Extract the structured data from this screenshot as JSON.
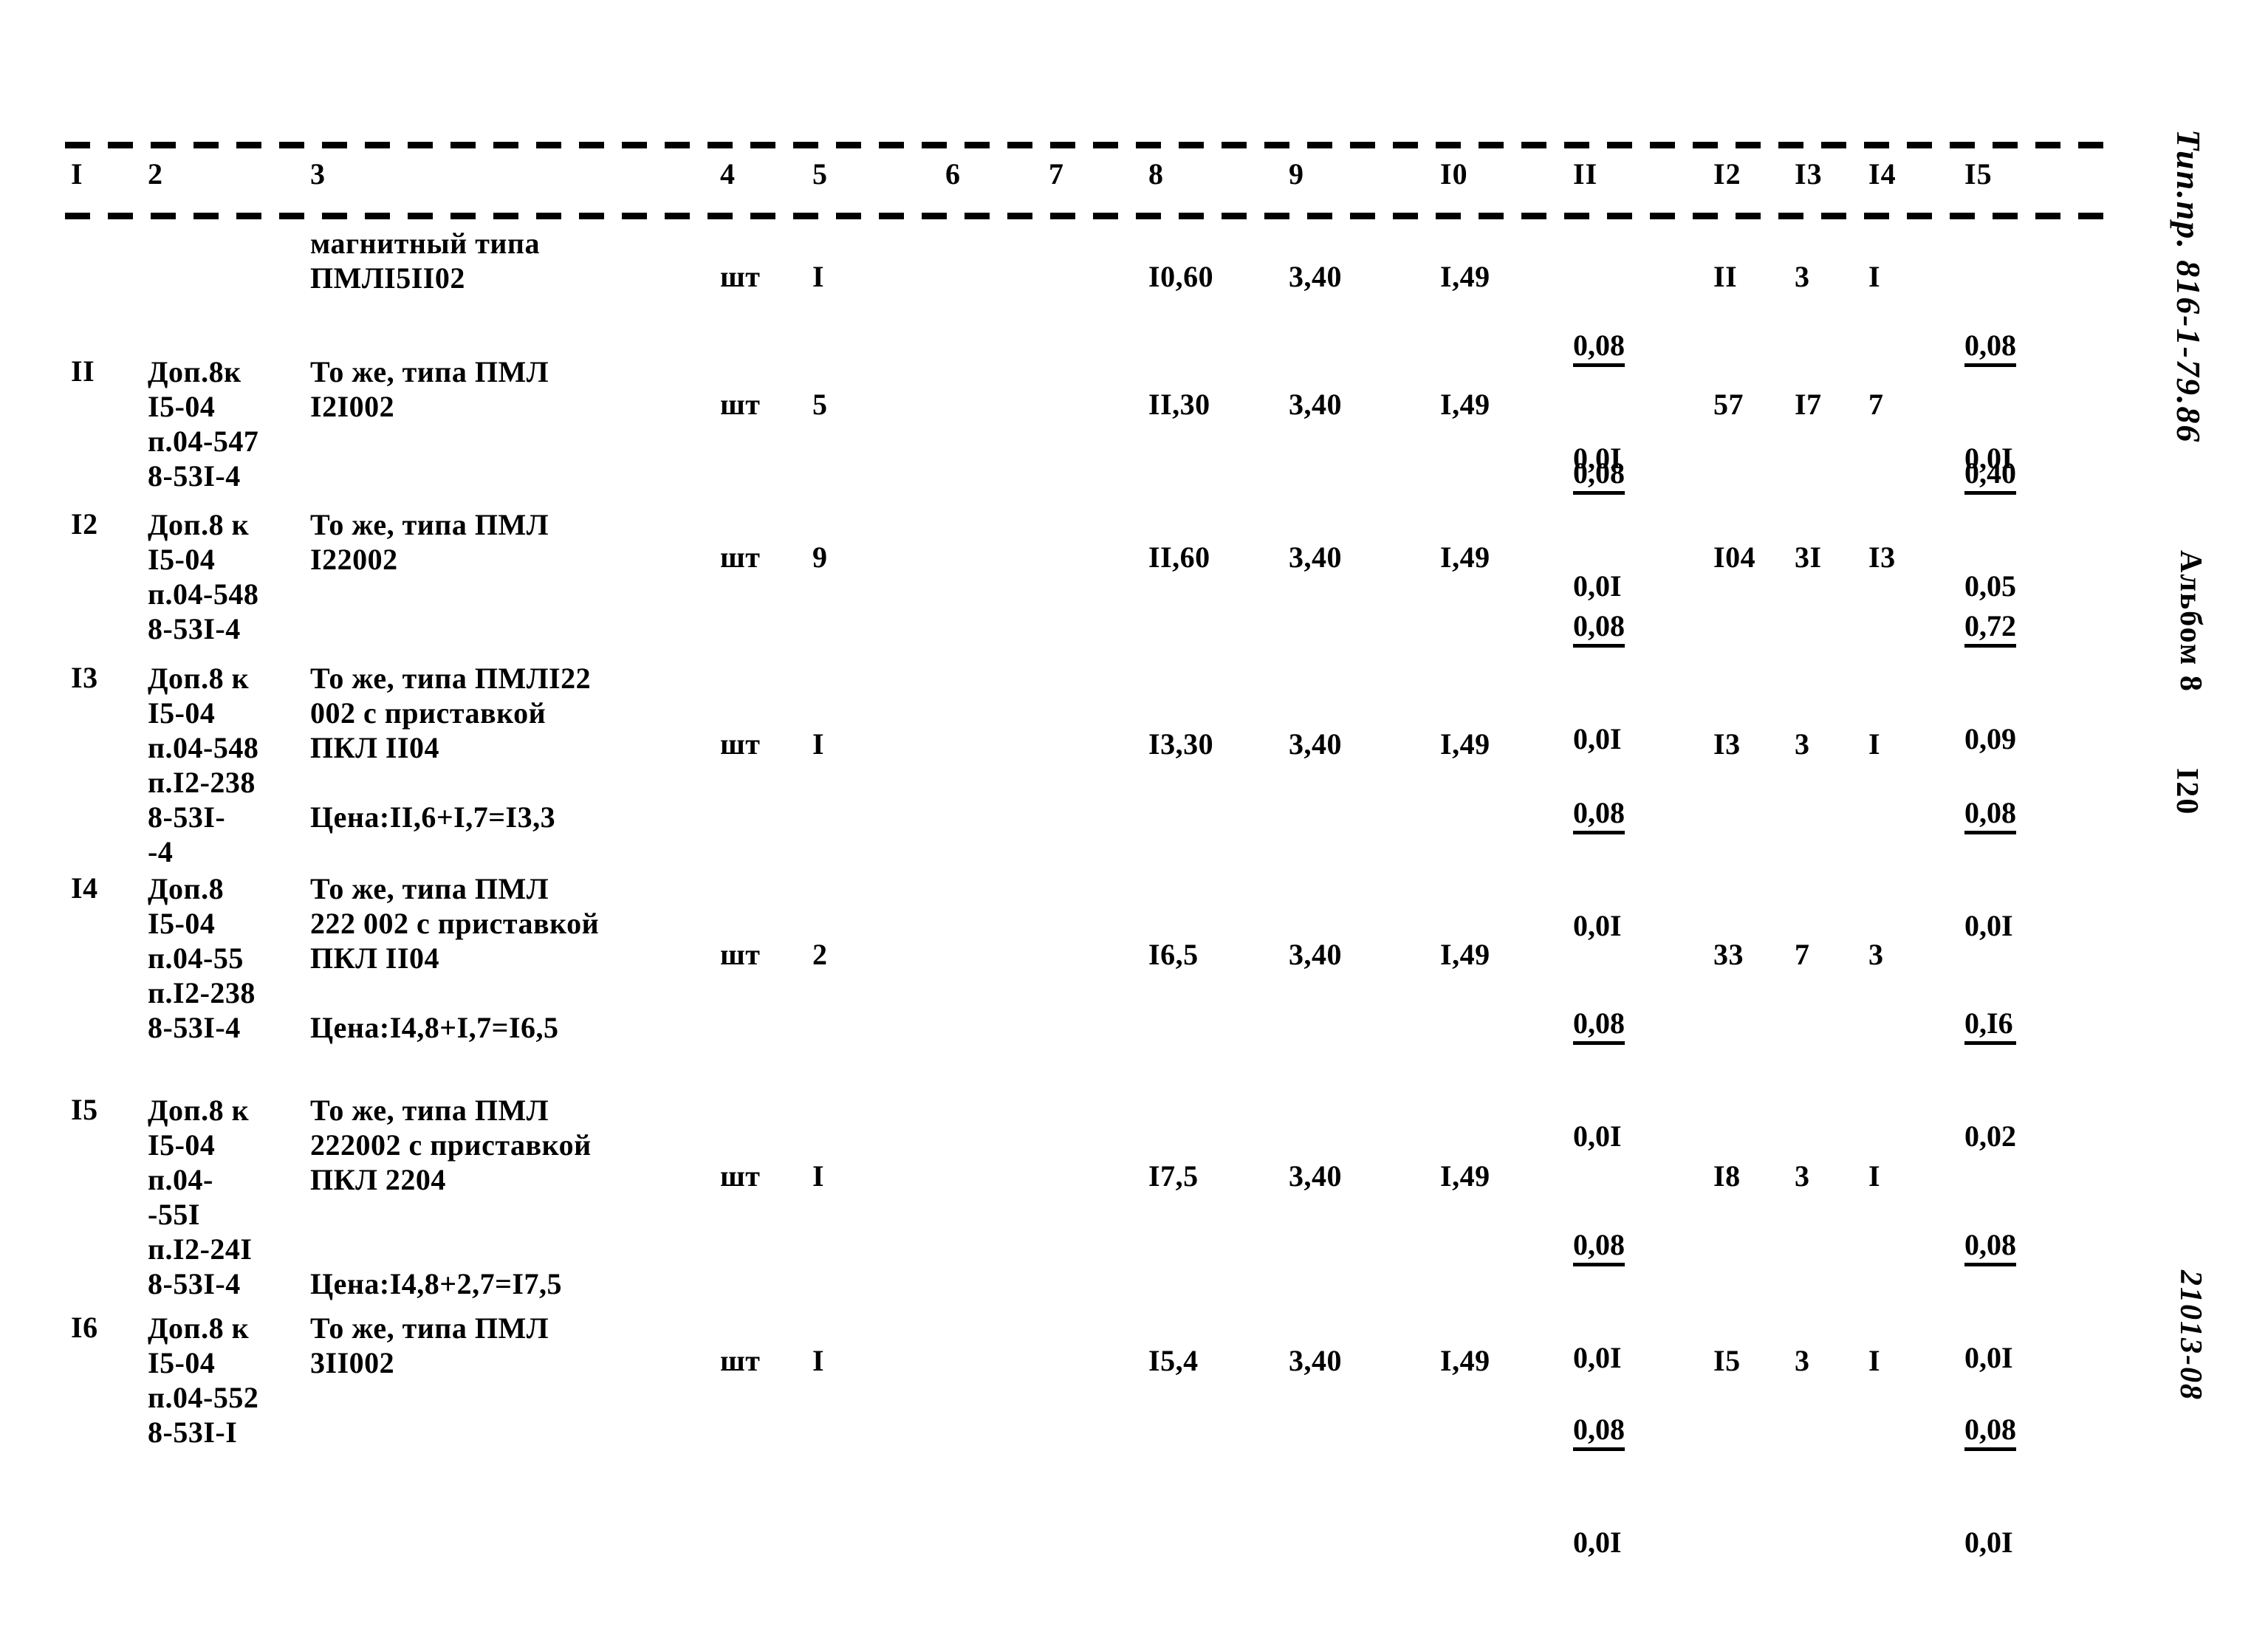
{
  "document": {
    "type": "estimate-table",
    "margin_vertical": {
      "project_code": "Тип.пр. 816-1-79.86",
      "album": "Альбом 8",
      "page_number": "I20",
      "doc_code": "21013-08"
    }
  },
  "table": {
    "column_headers": [
      "I",
      "2",
      "3",
      "4",
      "5",
      "6",
      "7",
      "8",
      "9",
      "I0",
      "II",
      "I2",
      "I3",
      "I4",
      "I5"
    ],
    "rows": [
      {
        "c1": "",
        "c2": "",
        "c3": "магнитный типа\nПМЛI5II02",
        "c4": "шт",
        "c5": "I",
        "c6": "",
        "c7": "",
        "c8": "I0,60",
        "c9": "3,40",
        "c10": "I,49",
        "c11_num": "0,08",
        "c11_den": "0,0I",
        "c12": "II",
        "c13": "3",
        "c14": "I",
        "c15_num": "0,08",
        "c15_den": "0,0I"
      },
      {
        "c1": "II",
        "c2": "Доп.8к\nI5-04\nп.04-547\n8-53I-4",
        "c3": "То же, типа ПМЛ\nI2I002",
        "c4": "шт",
        "c5": "5",
        "c6": "",
        "c7": "",
        "c8": "II,30",
        "c9": "3,40",
        "c10": "I,49",
        "c11_num": "0,08",
        "c11_den": "0,0I",
        "c12": "57",
        "c13": "I7",
        "c14": "7",
        "c15_num": "0,40",
        "c15_den": "0,05"
      },
      {
        "c1": "I2",
        "c2": "Доп.8 к\nI5-04\nп.04-548\n8-53I-4",
        "c3": "То же, типа ПМЛ\nI22002",
        "c4": "шт",
        "c5": "9",
        "c6": "",
        "c7": "",
        "c8": "II,60",
        "c9": "3,40",
        "c10": "I,49",
        "c11_num": "0,08",
        "c11_den": "0,0I",
        "c12": "I04",
        "c13": "3I",
        "c14": "I3",
        "c15_num": "0,72",
        "c15_den": "0,09"
      },
      {
        "c1": "I3",
        "c2": "Доп.8 к\nI5-04\nп.04-548\nп.I2-238\n8-53I-\n-4",
        "c3": "То же, типа ПМЛI22\n002 с приставкой\nПКЛ II04\n\nЦена:II,6+I,7=I3,3",
        "c4": "шт",
        "c5": "I",
        "c6": "",
        "c7": "",
        "c8": "I3,30",
        "c9": "3,40",
        "c10": "I,49",
        "c11_num": "0,08",
        "c11_den": "0,0I",
        "c12": "I3",
        "c13": "3",
        "c14": "I",
        "c15_num": "0,08",
        "c15_den": "0,0I"
      },
      {
        "c1": "I4",
        "c2": "Доп.8\nI5-04\nп.04-55\nп.I2-238\n8-53I-4",
        "c3": "То же, типа ПМЛ\n222 002 с приставкой\nПКЛ II04\n\nЦена:I4,8+I,7=I6,5",
        "c4": "шт",
        "c5": "2",
        "c6": "",
        "c7": "",
        "c8": "I6,5",
        "c9": "3,40",
        "c10": "I,49",
        "c11_num": "0,08",
        "c11_den": "0,0I",
        "c12": "33",
        "c13": "7",
        "c14": "3",
        "c15_num": "0,I6",
        "c15_den": "0,02"
      },
      {
        "c1": "I5",
        "c2": "Доп.8 к\nI5-04\nп.04-\n-55I\nп.I2-24I\n8-53I-4",
        "c3": "То же, типа ПМЛ\n222002 с приставкой\nПКЛ 2204\n\n\nЦена:I4,8+2,7=I7,5",
        "c4": "шт",
        "c5": "I",
        "c6": "",
        "c7": "",
        "c8": "I7,5",
        "c9": "3,40",
        "c10": "I,49",
        "c11_num": "0,08",
        "c11_den": "0,0I",
        "c12": "I8",
        "c13": "3",
        "c14": "I",
        "c15_num": "0,08",
        "c15_den": "0,0I"
      },
      {
        "c1": "I6",
        "c2": "Доп.8 к\nI5-04\nп.04-552\n8-53I-I",
        "c3": "То же, типа ПМЛ\n3II002",
        "c4": "шт",
        "c5": "I",
        "c6": "",
        "c7": "",
        "c8": "I5,4",
        "c9": "3,40",
        "c10": "I,49",
        "c11_num": "0,08",
        "c11_den": "0,0I",
        "c12": "I5",
        "c13": "3",
        "c14": "I",
        "c15_num": "0,08",
        "c15_den": "0,0I"
      }
    ]
  }
}
